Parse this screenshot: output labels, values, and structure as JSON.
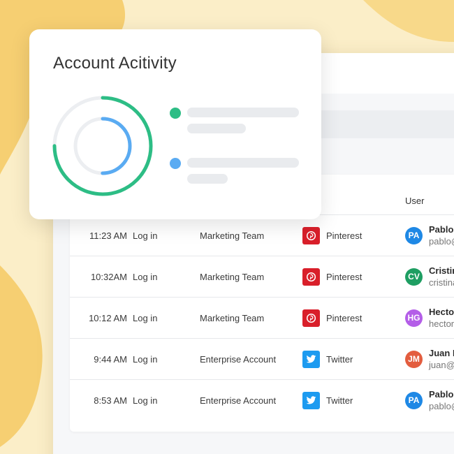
{
  "colors": {
    "background": "#fbeec8",
    "blob": "#f6cf72",
    "ring_outer": "#2dbd85",
    "ring_inner": "#5aabf2",
    "ring_track": "#eceef1",
    "pinterest": "#d91f2a",
    "twitter": "#1d9bf0"
  },
  "card": {
    "title": "Account Acitivity",
    "chart": {
      "series": [
        {
          "color": "#2dbd85",
          "fraction": 0.75
        },
        {
          "color": "#5aabf2",
          "fraction": 0.5
        }
      ]
    }
  },
  "table": {
    "header": {
      "user": "User"
    },
    "rows": [
      {
        "time": "11:23 AM",
        "activity": "Log in",
        "team": "Marketing Team",
        "source": "Pinterest",
        "source_icon": "pinterest-icon",
        "initials": "PA",
        "avatar_color": "#1e88e5",
        "name": "Pablo A",
        "email": "pablo@"
      },
      {
        "time": "10:32AM",
        "activity": "Log in",
        "team": "Marketing Team",
        "source": "Pinterest",
        "source_icon": "pinterest-icon",
        "initials": "CV",
        "avatar_color": "#1e9e62",
        "name": "Cristin",
        "email": "cristina"
      },
      {
        "time": "10:12 AM",
        "activity": "Log in",
        "team": "Marketing Team",
        "source": "Pinterest",
        "source_icon": "pinterest-icon",
        "initials": "HG",
        "avatar_color": "#b45ee8",
        "name": "Hector",
        "email": "hector"
      },
      {
        "time": "9:44 AM",
        "activity": "Log in",
        "team": "Enterprise Account",
        "source": "Twitter",
        "source_icon": "twitter-icon",
        "initials": "JM",
        "avatar_color": "#e35d3f",
        "name": "Juan M",
        "email": "juan@c"
      },
      {
        "time": "8:53 AM",
        "activity": "Log in",
        "team": "Enterprise Account",
        "source": "Twitter",
        "source_icon": "twitter-icon",
        "initials": "PA",
        "avatar_color": "#1e88e5",
        "name": "Pablo A",
        "email": "pablo@"
      }
    ]
  }
}
